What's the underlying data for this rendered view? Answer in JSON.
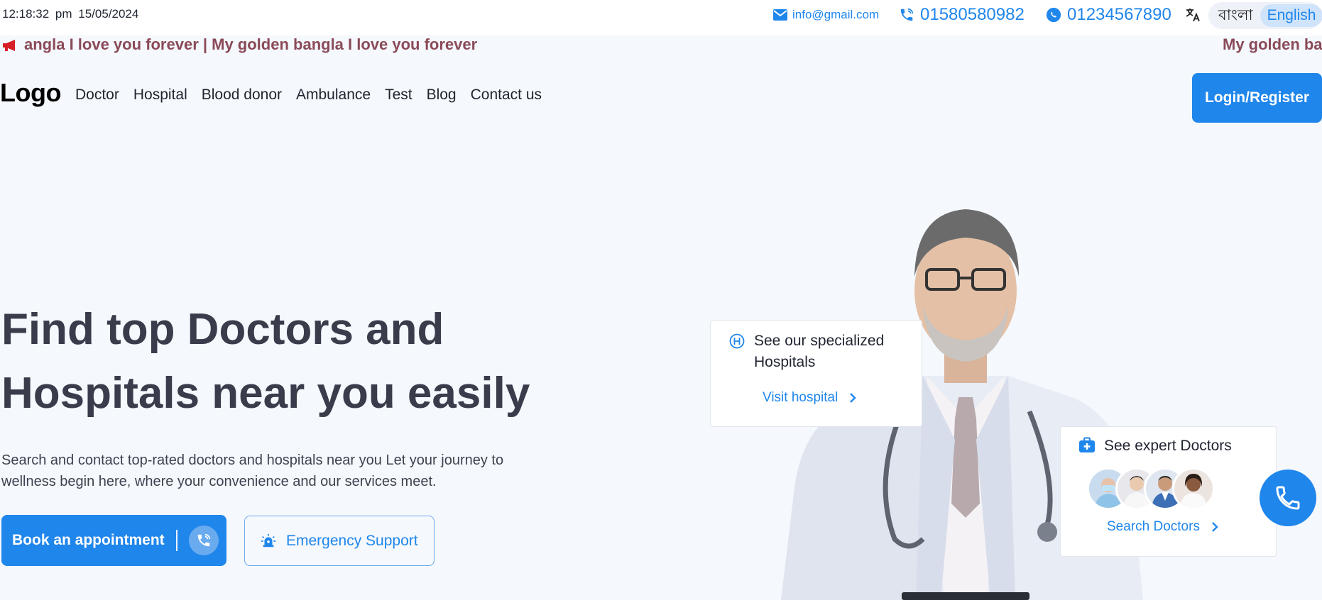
{
  "topbar": {
    "time": "12:18:32 pm",
    "date": "15/05/2024",
    "email": "info@gmail.com",
    "phone": "01580580982",
    "whatsapp": "01234567890",
    "languages": [
      "বাংলা",
      "English"
    ],
    "active_language": "English"
  },
  "marquee": {
    "segment_1": "angla I love you forever | My golden bangla I love you forever",
    "segment_2": "My golden ba"
  },
  "nav": {
    "logo": "Logo",
    "items": [
      "Doctor",
      "Hospital",
      "Blood donor",
      "Ambulance",
      "Test",
      "Blog",
      "Contact us"
    ],
    "login_label": "Login/Register"
  },
  "hero": {
    "title_line1": "Find top Doctors and",
    "title_line2": "Hospitals near you easily",
    "desc_line1": "Search and contact top-rated doctors and hospitals near you Let your journey to",
    "desc_line2": "wellness begin here, where your convenience and our services meet.",
    "book_label": "Book an appointment",
    "emergency_label": "Emergency Support"
  },
  "cards": {
    "hospital_title": "See our specialized Hospitals",
    "hospital_link": "Visit hospital",
    "doctor_title": "See expert Doctors",
    "doctor_link": "Search Doctors"
  },
  "colors": {
    "primary": "#1f86ec",
    "background": "#f5f8fc",
    "marquee_text": "#8a4a58",
    "heading": "#3a3c4c"
  },
  "icons": {
    "email": "mail-icon",
    "phone": "phone-call-icon",
    "whatsapp": "whatsapp-icon",
    "translate": "translate-icon",
    "marquee": "megaphone-icon",
    "hospital": "hospital-h-icon",
    "doctor": "medical-kit-icon",
    "call": "phone-icon",
    "emergency": "siren-icon",
    "chevron": "chevron-right-icon"
  }
}
